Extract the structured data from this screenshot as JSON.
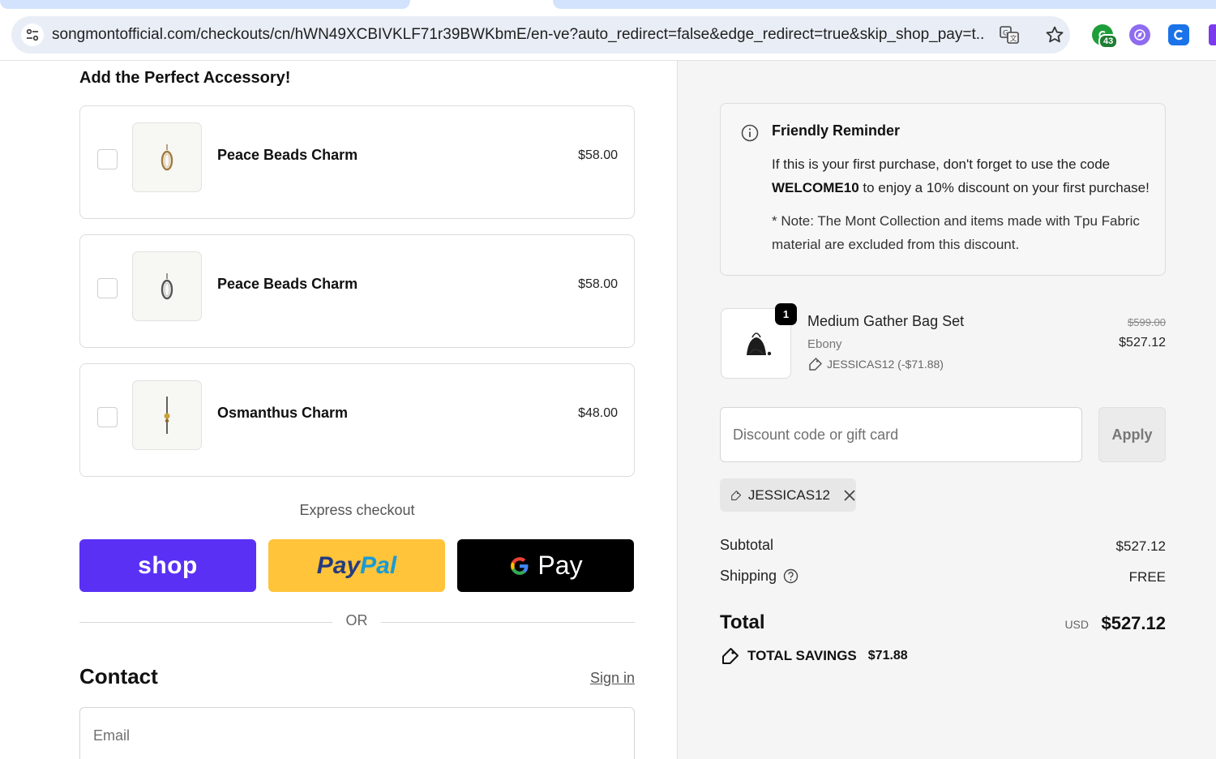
{
  "browser": {
    "url": "songmontofficial.com/checkouts/cn/hWN49XCBIVKLF71r39BWKbmE/en-ve?auto_redirect=false&edge_redirect=true&skip_shop_pay=t...",
    "extension_badge": "43"
  },
  "accessories": {
    "title": "Add the Perfect Accessory!",
    "items": [
      {
        "name": "Peace Beads Charm",
        "price": "$58.00",
        "icon": "charm-ring-icon"
      },
      {
        "name": "Peace Beads Charm",
        "price": "$58.00",
        "icon": "charm-ring-icon"
      },
      {
        "name": "Osmanthus Charm",
        "price": "$48.00",
        "icon": "charm-pendant-icon"
      }
    ]
  },
  "express": {
    "label": "Express checkout",
    "shop_label": "shop",
    "paypal_a": "Pay",
    "paypal_b": "Pal",
    "gpay_label": "Pay",
    "or_label": "OR"
  },
  "contact": {
    "title": "Contact",
    "signin": "Sign in",
    "email_placeholder": "Email"
  },
  "reminder": {
    "title": "Friendly Reminder",
    "line1": "If this is your first purchase, don't forget to use the code",
    "code": "WELCOME10",
    "line2": " to enjoy a 10% discount on your first purchase!",
    "note": "* Note: The Mont Collection and items made with Tpu Fabric material are excluded from this discount."
  },
  "cart_item": {
    "quantity": "1",
    "name": "Medium Gather Bag Set",
    "variant": "Ebony",
    "discount_text": "JESSICAS12 (-$71.88)",
    "old_price": "$599.00",
    "price": "$527.12"
  },
  "discount": {
    "placeholder": "Discount code or gift card",
    "apply_label": "Apply",
    "applied_code": "JESSICAS12"
  },
  "summary": {
    "subtotal_label": "Subtotal",
    "subtotal_value": "$527.12",
    "shipping_label": "Shipping",
    "shipping_value": "FREE",
    "total_label": "Total",
    "currency": "USD",
    "total_value": "$527.12",
    "savings_label": "TOTAL SAVINGS",
    "savings_value": "$71.88"
  },
  "colors": {
    "shop_purple": "#5a31f4",
    "paypal_yellow": "#ffc439",
    "gpay_black": "#000000"
  }
}
